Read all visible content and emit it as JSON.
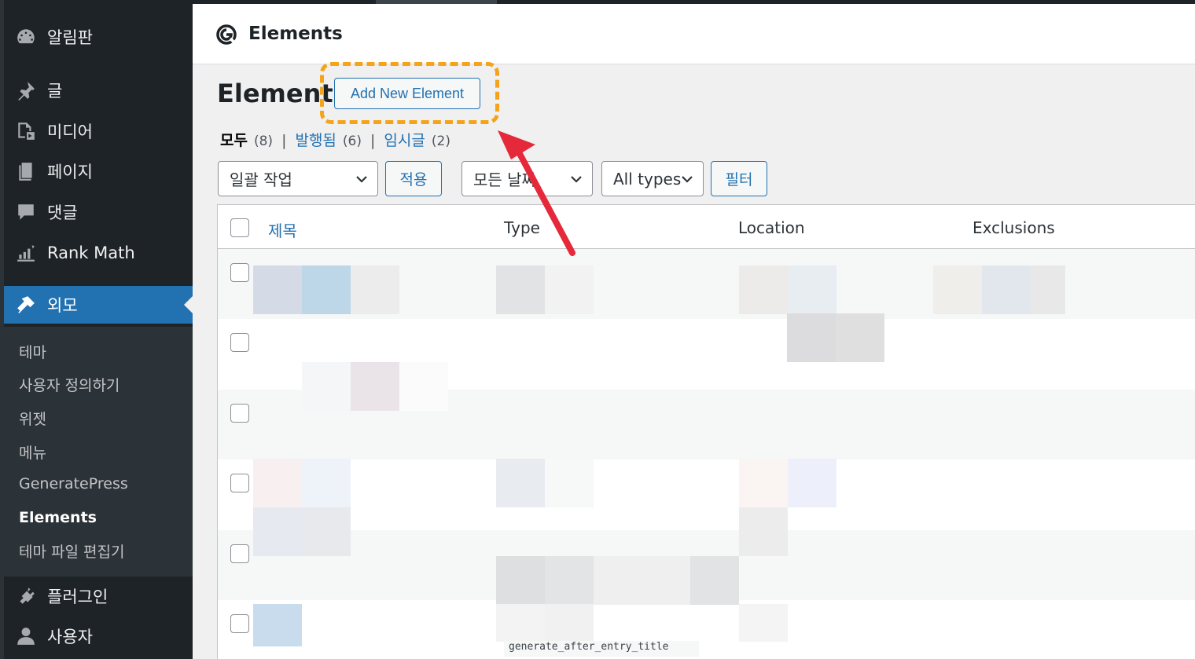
{
  "sidebar": {
    "items": [
      {
        "label": "알림판",
        "icon": "dashboard-icon"
      },
      {
        "label": "글",
        "icon": "pin-icon"
      },
      {
        "label": "미디어",
        "icon": "media-icon"
      },
      {
        "label": "페이지",
        "icon": "pages-icon"
      },
      {
        "label": "댓글",
        "icon": "comments-icon"
      },
      {
        "label": "Rank Math",
        "icon": "rank-math-icon"
      },
      {
        "label": "외모",
        "icon": "appearance-brush-icon"
      },
      {
        "label": "플러그인",
        "icon": "plugins-icon"
      },
      {
        "label": "사용자",
        "icon": "users-icon"
      }
    ],
    "submenu": [
      "테마",
      "사용자 정의하기",
      "위젯",
      "메뉴",
      "GeneratePress",
      "Elements",
      "테마 파일 편집기"
    ],
    "current_sub": "Elements"
  },
  "header": {
    "title": "Elements"
  },
  "page": {
    "title": "Elements",
    "add_button": "Add New Element"
  },
  "views": {
    "all_label": "모두",
    "all_count": "(8)",
    "published_label": "발행됨",
    "published_count": "(6)",
    "draft_label": "임시글",
    "draft_count": "(2)",
    "separator": "|"
  },
  "filters": {
    "bulk_action": "일괄 작업",
    "apply": "적용",
    "dates": "모든 날짜",
    "types": "All types",
    "filter": "필터"
  },
  "table": {
    "columns": [
      "제목",
      "Type",
      "Location",
      "Exclusions"
    ]
  },
  "tooltip": "generate_after_entry_title",
  "colors": {
    "sidebar_bg": "#1d2327",
    "submenu_bg": "#2c3338",
    "accent": "#2271b1",
    "highlight": "#f4a31a",
    "annotation_arrow": "#f0424a"
  }
}
